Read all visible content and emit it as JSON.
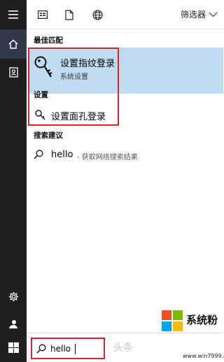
{
  "toolbar": {
    "icons": [
      "apps-icon",
      "document-icon",
      "web-icon"
    ],
    "filter_label": "筛选器"
  },
  "rail": {
    "items": [
      "menu-icon",
      "home-icon",
      "notebook-icon",
      "settings-icon",
      "user-icon",
      "windows-icon"
    ]
  },
  "sections": {
    "best_match": "最佳匹配",
    "settings": "设置",
    "web_suggestions": "搜索建议"
  },
  "best_match_item": {
    "title": "设置指纹登录",
    "subtitle": "系统设置",
    "icon": "key-icon"
  },
  "settings_item": {
    "label": "设置面孔登录",
    "icon": "key-icon"
  },
  "suggestion": {
    "term": "hello",
    "hint": "- 获取网络搜索结果",
    "icon": "search-icon"
  },
  "search": {
    "value": "hello"
  },
  "branding": {
    "name": "系统粉",
    "url": "www.win7999.com",
    "watermark": "头条"
  },
  "colors": {
    "rail_bg": "#1f1f1f",
    "rail_active": "#303a48",
    "highlight": "#bfdcf3",
    "annotation_red": "#d9232e"
  }
}
